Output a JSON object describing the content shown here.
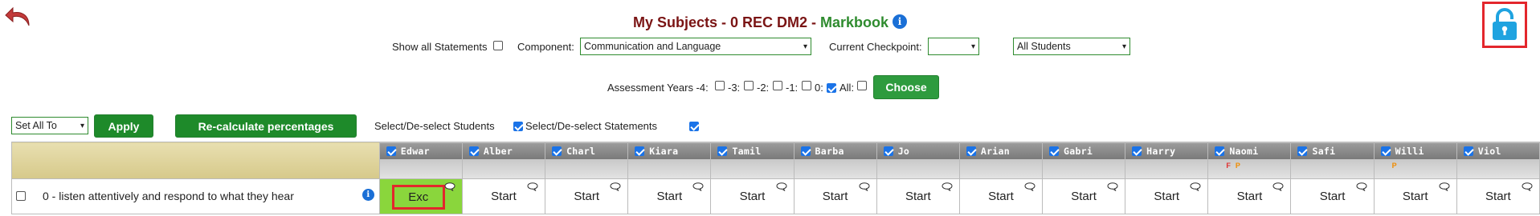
{
  "header": {
    "title_part1": "My Subjects - 0 REC DM2 - ",
    "title_part2": "Markbook",
    "info_icon": "i"
  },
  "filters": {
    "show_all_statements_label": "Show all Statements",
    "component_label": "Component:",
    "component_value": "Communication and Language",
    "checkpoint_label": "Current Checkpoint:",
    "checkpoint_value": "",
    "students_value": "All Students"
  },
  "assessment": {
    "label": "Assessment Years -4:",
    "opts": [
      "-3:",
      "-2:",
      "-1:",
      "0:",
      "All:"
    ],
    "choose_label": "Choose"
  },
  "toolbar": {
    "set_all_value": "Set All To",
    "apply_label": "Apply",
    "recalc_label": "Re-calculate percentages",
    "select_students_label": "Select/De-select Students",
    "select_statements_label": "Select/De-select Statements"
  },
  "students": [
    {
      "name": "Edwar",
      "flags": ""
    },
    {
      "name": "Alber",
      "flags": ""
    },
    {
      "name": "Charl",
      "flags": ""
    },
    {
      "name": "Kiara",
      "flags": ""
    },
    {
      "name": "Tamil",
      "flags": ""
    },
    {
      "name": "Barba",
      "flags": ""
    },
    {
      "name": "Jo",
      "flags": ""
    },
    {
      "name": "Arian",
      "flags": ""
    },
    {
      "name": "Gabri",
      "flags": ""
    },
    {
      "name": "Harry",
      "flags": ""
    },
    {
      "name": "Naomi",
      "flag_f": "F",
      "flag_p": "P"
    },
    {
      "name": "Safi",
      "flags": ""
    },
    {
      "name": "Willi",
      "flag_p": "P"
    },
    {
      "name": "Viol",
      "flags": ""
    }
  ],
  "statement": {
    "text": "0 - listen attentively and respond to what they hear",
    "values": [
      "Exc",
      "Start",
      "Start",
      "Start",
      "Start",
      "Start",
      "Start",
      "Start",
      "Start",
      "Start",
      "Start",
      "Start",
      "Start",
      "Start"
    ]
  },
  "colors": {
    "accent_green": "#2e9b3e",
    "highlight_red": "#e3262c",
    "selected_cell": "#8ad63c",
    "title_maroon": "#7a1414",
    "info_blue": "#1a6fd6",
    "lock_blue": "#1fa3e0"
  },
  "icons": {
    "back": "undo-arrow-icon",
    "lock": "padlock-icon",
    "comment": "speech-bubble-icon",
    "info": "info-icon"
  }
}
